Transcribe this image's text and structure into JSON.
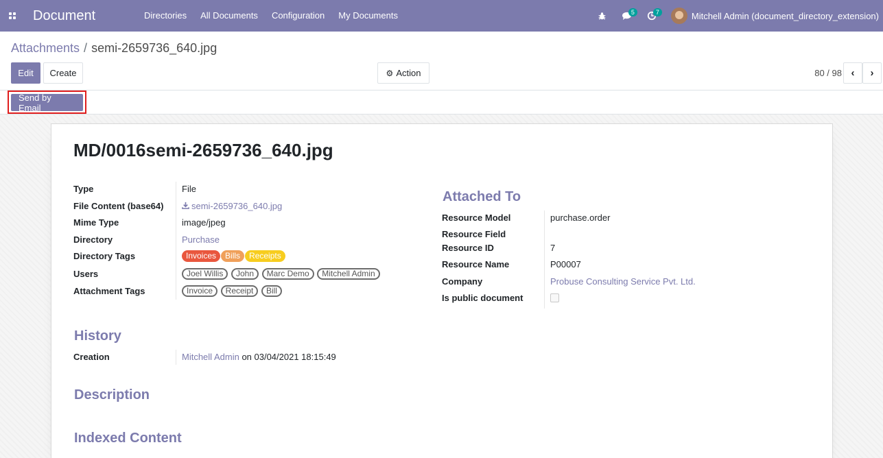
{
  "navbar": {
    "brand": "Document",
    "menu": [
      "Directories",
      "All Documents",
      "Configuration",
      "My Documents"
    ],
    "messages_badge": "5",
    "activities_badge": "7",
    "user": "Mitchell Admin (document_directory_extension)"
  },
  "breadcrumb": {
    "parent": "Attachments",
    "separator": "/",
    "current": "semi-2659736_640.jpg"
  },
  "buttons": {
    "edit": "Edit",
    "create": "Create",
    "action": "Action",
    "send_email": "Send by Email"
  },
  "pager": {
    "value": "80 / 98"
  },
  "record": {
    "title": "MD/0016semi-2659736_640.jpg",
    "left_fields": {
      "type_label": "Type",
      "type_value": "File",
      "file_label": "File Content (base64)",
      "file_value": "semi-2659736_640.jpg",
      "mime_label": "Mime Type",
      "mime_value": "image/jpeg",
      "directory_label": "Directory",
      "directory_value": "Purchase",
      "dir_tags_label": "Directory Tags",
      "users_label": "Users",
      "attach_tags_label": "Attachment Tags"
    },
    "directory_tags": [
      {
        "label": "Invoices",
        "color": "#e9573e"
      },
      {
        "label": "Bills",
        "color": "#f0a05a"
      },
      {
        "label": "Receipts",
        "color": "#f7cd1f"
      }
    ],
    "users": [
      "Joel Willis",
      "John",
      "Marc Demo",
      "Mitchell Admin"
    ],
    "attachment_tags": [
      "Invoice",
      "Receipt",
      "Bill"
    ],
    "attached_to": {
      "heading": "Attached To",
      "resource_model_label": "Resource Model",
      "resource_model_value": "purchase.order",
      "resource_field_label": "Resource Field",
      "resource_field_value": "",
      "resource_id_label": "Resource ID",
      "resource_id_value": "7",
      "resource_name_label": "Resource Name",
      "resource_name_value": "P00007",
      "company_label": "Company",
      "company_value": "Probuse Consulting Service Pvt. Ltd.",
      "public_label": "Is public document",
      "public_value": false
    },
    "history": {
      "heading": "History",
      "creation_label": "Creation",
      "creation_user": "Mitchell Admin",
      "creation_rest": "on 03/04/2021 18:15:49"
    },
    "description_heading": "Description",
    "indexed_heading": "Indexed Content"
  },
  "colors": {
    "brand": "#7c7bad",
    "badge": "#00a09d",
    "highlight": "#e01d1d"
  }
}
